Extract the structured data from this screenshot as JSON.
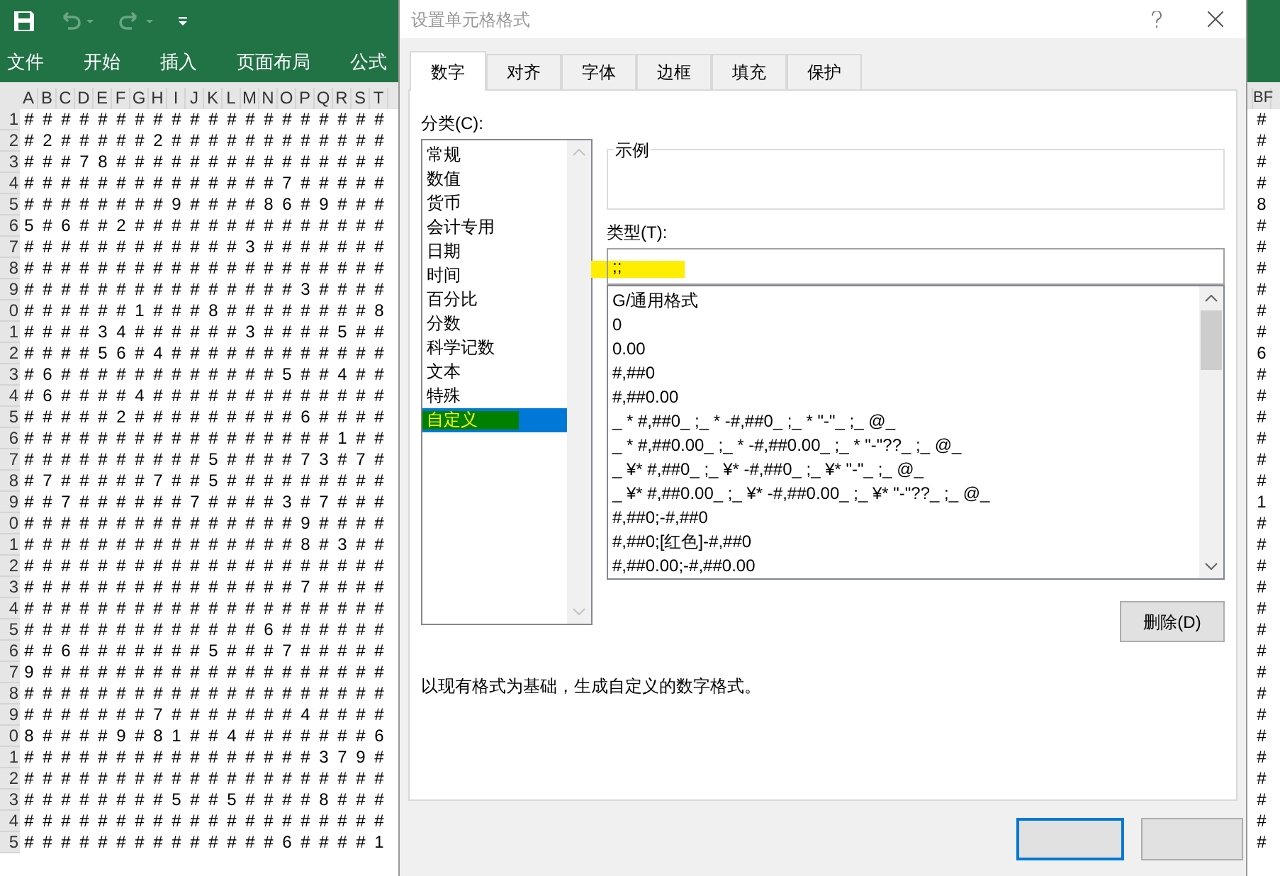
{
  "ribbon_tabs": [
    "文件",
    "开始",
    "插入",
    "页面布局",
    "公式"
  ],
  "sheet": {
    "columns": [
      "A",
      "B",
      "C",
      "D",
      "E",
      "F",
      "G",
      "H",
      "I",
      "J",
      "K",
      "L",
      "M",
      "N",
      "O",
      "P",
      "Q",
      "R",
      "S",
      "T"
    ],
    "rows": [
      {
        "header": "1",
        "cells": [
          "#",
          "#",
          "#",
          "#",
          "#",
          "#",
          "#",
          "#",
          "#",
          "#",
          "#",
          "#",
          "#",
          "#",
          "#",
          "#",
          "#",
          "#",
          "#",
          "#"
        ]
      },
      {
        "header": "2",
        "cells": [
          "#",
          "2",
          "#",
          "#",
          "#",
          "#",
          "#",
          "2",
          "#",
          "#",
          "#",
          "#",
          "#",
          "#",
          "#",
          "#",
          "#",
          "#",
          "#",
          "#"
        ]
      },
      {
        "header": "3",
        "cells": [
          "#",
          "#",
          "#",
          "7",
          "8",
          "#",
          "#",
          "#",
          "#",
          "#",
          "#",
          "#",
          "#",
          "#",
          "#",
          "#",
          "#",
          "#",
          "#",
          "#"
        ]
      },
      {
        "header": "4",
        "cells": [
          "#",
          "#",
          "#",
          "#",
          "#",
          "#",
          "#",
          "#",
          "#",
          "#",
          "#",
          "#",
          "#",
          "#",
          "7",
          "#",
          "#",
          "#",
          "#",
          "#"
        ]
      },
      {
        "header": "5",
        "cells": [
          "#",
          "#",
          "#",
          "#",
          "#",
          "#",
          "#",
          "#",
          "9",
          "#",
          "#",
          "#",
          "#",
          "8",
          "6",
          "#",
          "9",
          "#",
          "#",
          "#"
        ]
      },
      {
        "header": "6",
        "cells": [
          "5",
          "#",
          "6",
          "#",
          "#",
          "2",
          "#",
          "#",
          "#",
          "#",
          "#",
          "#",
          "#",
          "#",
          "#",
          "#",
          "#",
          "#",
          "#",
          "#"
        ]
      },
      {
        "header": "7",
        "cells": [
          "#",
          "#",
          "#",
          "#",
          "#",
          "#",
          "#",
          "#",
          "#",
          "#",
          "#",
          "#",
          "3",
          "#",
          "#",
          "#",
          "#",
          "#",
          "#",
          "#"
        ]
      },
      {
        "header": "8",
        "cells": [
          "#",
          "#",
          "#",
          "#",
          "#",
          "#",
          "#",
          "#",
          "#",
          "#",
          "#",
          "#",
          "#",
          "#",
          "#",
          "#",
          "#",
          "#",
          "#",
          "#"
        ]
      },
      {
        "header": "9",
        "cells": [
          "#",
          "#",
          "#",
          "#",
          "#",
          "#",
          "#",
          "#",
          "#",
          "#",
          "#",
          "#",
          "#",
          "#",
          "#",
          "3",
          "#",
          "#",
          "#",
          "#"
        ]
      },
      {
        "header": "0",
        "cells": [
          "#",
          "#",
          "#",
          "#",
          "#",
          "#",
          "1",
          "#",
          "#",
          "#",
          "8",
          "#",
          "#",
          "#",
          "#",
          "#",
          "#",
          "#",
          "#",
          "8"
        ]
      },
      {
        "header": "1",
        "cells": [
          "#",
          "#",
          "#",
          "#",
          "3",
          "4",
          "#",
          "#",
          "#",
          "#",
          "#",
          "#",
          "3",
          "#",
          "#",
          "#",
          "#",
          "5",
          "#",
          "#"
        ]
      },
      {
        "header": "2",
        "cells": [
          "#",
          "#",
          "#",
          "#",
          "5",
          "6",
          "#",
          "4",
          "#",
          "#",
          "#",
          "#",
          "#",
          "#",
          "#",
          "#",
          "#",
          "#",
          "#",
          "#"
        ]
      },
      {
        "header": "3",
        "cells": [
          "#",
          "6",
          "#",
          "#",
          "#",
          "#",
          "#",
          "#",
          "#",
          "#",
          "#",
          "#",
          "#",
          "#",
          "5",
          "#",
          "#",
          "4",
          "#",
          "#"
        ]
      },
      {
        "header": "4",
        "cells": [
          "#",
          "6",
          "#",
          "#",
          "#",
          "#",
          "4",
          "#",
          "#",
          "#",
          "#",
          "#",
          "#",
          "#",
          "#",
          "#",
          "#",
          "#",
          "#",
          "#"
        ]
      },
      {
        "header": "5",
        "cells": [
          "#",
          "#",
          "#",
          "#",
          "#",
          "2",
          "#",
          "#",
          "#",
          "#",
          "#",
          "#",
          "#",
          "#",
          "#",
          "6",
          "#",
          "#",
          "#",
          "#"
        ]
      },
      {
        "header": "6",
        "cells": [
          "#",
          "#",
          "#",
          "#",
          "#",
          "#",
          "#",
          "#",
          "#",
          "#",
          "#",
          "#",
          "#",
          "#",
          "#",
          "#",
          "#",
          "1",
          "#",
          "#"
        ]
      },
      {
        "header": "7",
        "cells": [
          "#",
          "#",
          "#",
          "#",
          "#",
          "#",
          "#",
          "#",
          "#",
          "#",
          "5",
          "#",
          "#",
          "#",
          "#",
          "7",
          "3",
          "#",
          "7",
          "#"
        ]
      },
      {
        "header": "8",
        "cells": [
          "#",
          "7",
          "#",
          "#",
          "#",
          "#",
          "#",
          "7",
          "#",
          "#",
          "5",
          "#",
          "#",
          "#",
          "#",
          "#",
          "#",
          "#",
          "#",
          "#"
        ]
      },
      {
        "header": "9",
        "cells": [
          "#",
          "#",
          "7",
          "#",
          "#",
          "#",
          "#",
          "#",
          "#",
          "7",
          "#",
          "#",
          "#",
          "#",
          "3",
          "#",
          "7",
          "#",
          "#",
          "#"
        ]
      },
      {
        "header": "0",
        "cells": [
          "#",
          "#",
          "#",
          "#",
          "#",
          "#",
          "#",
          "#",
          "#",
          "#",
          "#",
          "#",
          "#",
          "#",
          "#",
          "9",
          "#",
          "#",
          "#",
          "#"
        ]
      },
      {
        "header": "1",
        "cells": [
          "#",
          "#",
          "#",
          "#",
          "#",
          "#",
          "#",
          "#",
          "#",
          "#",
          "#",
          "#",
          "#",
          "#",
          "#",
          "8",
          "#",
          "3",
          "#",
          "#"
        ]
      },
      {
        "header": "2",
        "cells": [
          "#",
          "#",
          "#",
          "#",
          "#",
          "#",
          "#",
          "#",
          "#",
          "#",
          "#",
          "#",
          "#",
          "#",
          "#",
          "#",
          "#",
          "#",
          "#",
          "#"
        ]
      },
      {
        "header": "3",
        "cells": [
          "#",
          "#",
          "#",
          "#",
          "#",
          "#",
          "#",
          "#",
          "#",
          "#",
          "#",
          "#",
          "#",
          "#",
          "#",
          "7",
          "#",
          "#",
          "#",
          "#"
        ]
      },
      {
        "header": "4",
        "cells": [
          "#",
          "#",
          "#",
          "#",
          "#",
          "#",
          "#",
          "#",
          "#",
          "#",
          "#",
          "#",
          "#",
          "#",
          "#",
          "#",
          "#",
          "#",
          "#",
          "#"
        ]
      },
      {
        "header": "5",
        "cells": [
          "#",
          "#",
          "#",
          "#",
          "#",
          "#",
          "#",
          "#",
          "#",
          "#",
          "#",
          "#",
          "#",
          "6",
          "#",
          "#",
          "#",
          "#",
          "#",
          "#"
        ]
      },
      {
        "header": "6",
        "cells": [
          "#",
          "#",
          "6",
          "#",
          "#",
          "#",
          "#",
          "#",
          "#",
          "#",
          "5",
          "#",
          "#",
          "#",
          "7",
          "#",
          "#",
          "#",
          "#",
          "#"
        ]
      },
      {
        "header": "7",
        "cells": [
          "9",
          "#",
          "#",
          "#",
          "#",
          "#",
          "#",
          "#",
          "#",
          "#",
          "#",
          "#",
          "#",
          "#",
          "#",
          "#",
          "#",
          "#",
          "#",
          "#"
        ]
      },
      {
        "header": "8",
        "cells": [
          "#",
          "#",
          "#",
          "#",
          "#",
          "#",
          "#",
          "#",
          "#",
          "#",
          "#",
          "#",
          "#",
          "#",
          "#",
          "#",
          "#",
          "#",
          "#",
          "#"
        ]
      },
      {
        "header": "9",
        "cells": [
          "#",
          "#",
          "#",
          "#",
          "#",
          "#",
          "#",
          "7",
          "#",
          "#",
          "#",
          "#",
          "#",
          "#",
          "#",
          "4",
          "#",
          "#",
          "#",
          "#"
        ]
      },
      {
        "header": "0",
        "cells": [
          "8",
          "#",
          "#",
          "#",
          "#",
          "9",
          "#",
          "8",
          "1",
          "#",
          "#",
          "4",
          "#",
          "#",
          "#",
          "#",
          "#",
          "#",
          "#",
          "6"
        ]
      },
      {
        "header": "1",
        "cells": [
          "#",
          "#",
          "#",
          "#",
          "#",
          "#",
          "#",
          "#",
          "#",
          "#",
          "#",
          "#",
          "#",
          "#",
          "#",
          "#",
          "3",
          "7",
          "9",
          "#"
        ]
      },
      {
        "header": "2",
        "cells": [
          "#",
          "#",
          "#",
          "#",
          "#",
          "#",
          "#",
          "#",
          "#",
          "#",
          "#",
          "#",
          "#",
          "#",
          "#",
          "#",
          "#",
          "#",
          "#",
          "#"
        ]
      },
      {
        "header": "3",
        "cells": [
          "#",
          "#",
          "#",
          "#",
          "#",
          "#",
          "#",
          "#",
          "5",
          "#",
          "#",
          "5",
          "#",
          "#",
          "#",
          "#",
          "8",
          "#",
          "#",
          "#"
        ]
      },
      {
        "header": "4",
        "cells": [
          "#",
          "#",
          "#",
          "#",
          "#",
          "#",
          "#",
          "#",
          "#",
          "#",
          "#",
          "#",
          "#",
          "#",
          "#",
          "#",
          "#",
          "#",
          "#",
          "#"
        ]
      },
      {
        "header": "5",
        "cells": [
          "#",
          "#",
          "#",
          "#",
          "#",
          "#",
          "#",
          "#",
          "#",
          "#",
          "#",
          "#",
          "#",
          "#",
          "6",
          "#",
          "#",
          "#",
          "#",
          "1"
        ]
      }
    ],
    "right_column": "BF",
    "right_cells": [
      "#",
      "#",
      "#",
      "#",
      "8",
      "#",
      "#",
      "#",
      "#",
      "#",
      "#",
      "6",
      "#",
      "#",
      "#",
      "#",
      "#",
      "#",
      "1",
      "#",
      "#",
      "#",
      "#",
      "#",
      "#",
      "#",
      "#",
      "#",
      "#",
      "#",
      "#",
      "#",
      "#",
      "#",
      "#"
    ]
  },
  "dialog": {
    "title": "设置单元格格式",
    "tabs": [
      {
        "label": "数字",
        "selected": true
      },
      {
        "label": "对齐",
        "selected": false
      },
      {
        "label": "字体",
        "selected": false
      },
      {
        "label": "边框",
        "selected": false
      },
      {
        "label": "填充",
        "selected": false
      },
      {
        "label": "保护",
        "selected": false
      }
    ],
    "category_label": "分类(C):",
    "categories": [
      {
        "label": "常规",
        "selected": false
      },
      {
        "label": "数值",
        "selected": false
      },
      {
        "label": "货币",
        "selected": false
      },
      {
        "label": "会计专用",
        "selected": false
      },
      {
        "label": "日期",
        "selected": false
      },
      {
        "label": "时间",
        "selected": false
      },
      {
        "label": "百分比",
        "selected": false
      },
      {
        "label": "分数",
        "selected": false
      },
      {
        "label": "科学记数",
        "selected": false
      },
      {
        "label": "文本",
        "selected": false
      },
      {
        "label": "特殊",
        "selected": false
      },
      {
        "label": "自定义",
        "selected": true
      }
    ],
    "sample_label": "示例",
    "type_label": "类型(T):",
    "type_value": ";;",
    "formats": [
      "G/通用格式",
      "0",
      "0.00",
      "#,##0",
      "#,##0.00",
      "_ * #,##0_ ;_ * -#,##0_ ;_ * \"-\"_ ;_ @_",
      "_ * #,##0.00_ ;_ * -#,##0.00_ ;_ * \"-\"??_ ;_ @_",
      "_ ¥* #,##0_ ;_ ¥* -#,##0_ ;_ ¥* \"-\"_ ;_ @_",
      "_ ¥* #,##0.00_ ;_ ¥* -#,##0.00_ ;_ ¥* \"-\"??_ ;_ @_",
      "#,##0;-#,##0",
      "#,##0;[红色]-#,##0",
      "#,##0.00;-#,##0.00"
    ],
    "delete_button": "删除(D)",
    "description": "以现有格式为基础，生成自定义的数字格式。"
  }
}
